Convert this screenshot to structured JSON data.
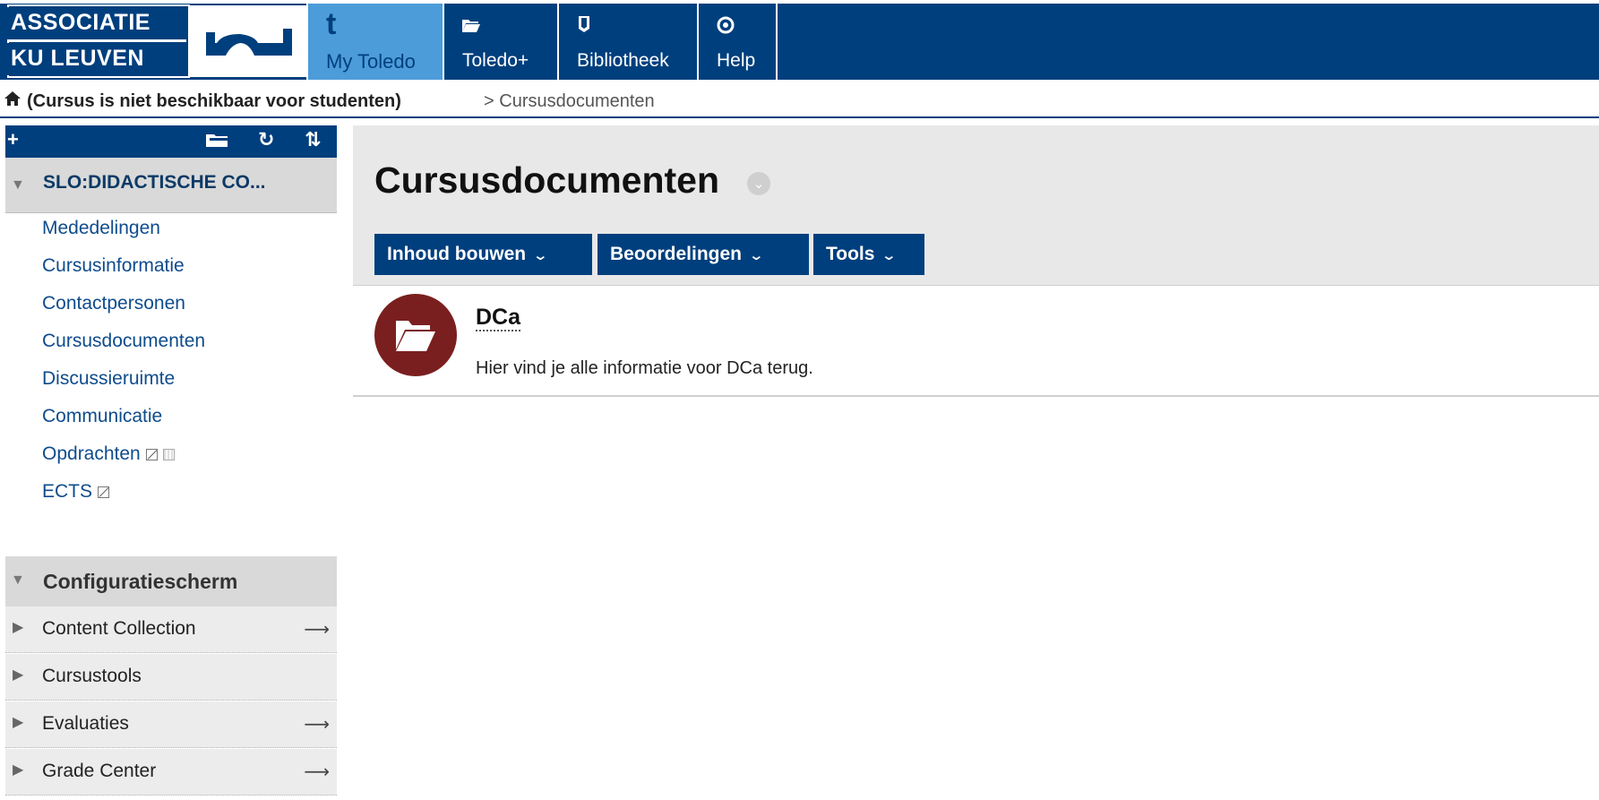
{
  "header": {
    "logo": {
      "line1": "ASSOCIATIE",
      "line2": "KU LEUVEN"
    },
    "tabs": [
      {
        "icon": "toledo-t-icon",
        "label": "My Toledo",
        "active": true
      },
      {
        "icon": "folder-icon",
        "label": "Toledo+"
      },
      {
        "icon": "book-icon",
        "label": "Bibliotheek"
      },
      {
        "icon": "lifebuoy-icon",
        "label": "Help"
      }
    ],
    "bar_color": "#003f7d",
    "active_color": "#4c9cd9"
  },
  "breadcrumb": {
    "course": "(Cursus is niet beschikbaar voor studenten)",
    "separator": ">",
    "current": "Cursusdocumenten"
  },
  "sidebar": {
    "toolbar_icons": [
      "plus-icon",
      "folder-icon",
      "refresh-icon",
      "sort-icon"
    ],
    "course_title": "SLO:DIDACTISCHE CO...",
    "links": [
      {
        "label": "Mededelingen"
      },
      {
        "label": "Cursusinformatie"
      },
      {
        "label": "Contactpersonen"
      },
      {
        "label": "Cursusdocumenten"
      },
      {
        "label": "Discussieruimte"
      },
      {
        "label": "Communicatie"
      },
      {
        "label": "Opdrachten"
      },
      {
        "label": "ECTS"
      }
    ],
    "config": {
      "title": "Configuratiescherm",
      "items": [
        {
          "label": "Content Collection",
          "has_arrow": true
        },
        {
          "label": "Cursustools",
          "has_arrow": false
        },
        {
          "label": "Evaluaties",
          "has_arrow": true
        },
        {
          "label": "Grade Center",
          "has_arrow": true
        }
      ]
    }
  },
  "main": {
    "title": "Cursusdocumenten",
    "actions": [
      {
        "label": "Inhoud bouwen"
      },
      {
        "label": "Beoordelingen"
      },
      {
        "label": "Tools"
      }
    ],
    "items": [
      {
        "title": "DCa",
        "description": "Hier vind je alle informatie voor DCa terug.",
        "icon": "folder-icon",
        "icon_color": "#7a1f1f"
      }
    ]
  }
}
